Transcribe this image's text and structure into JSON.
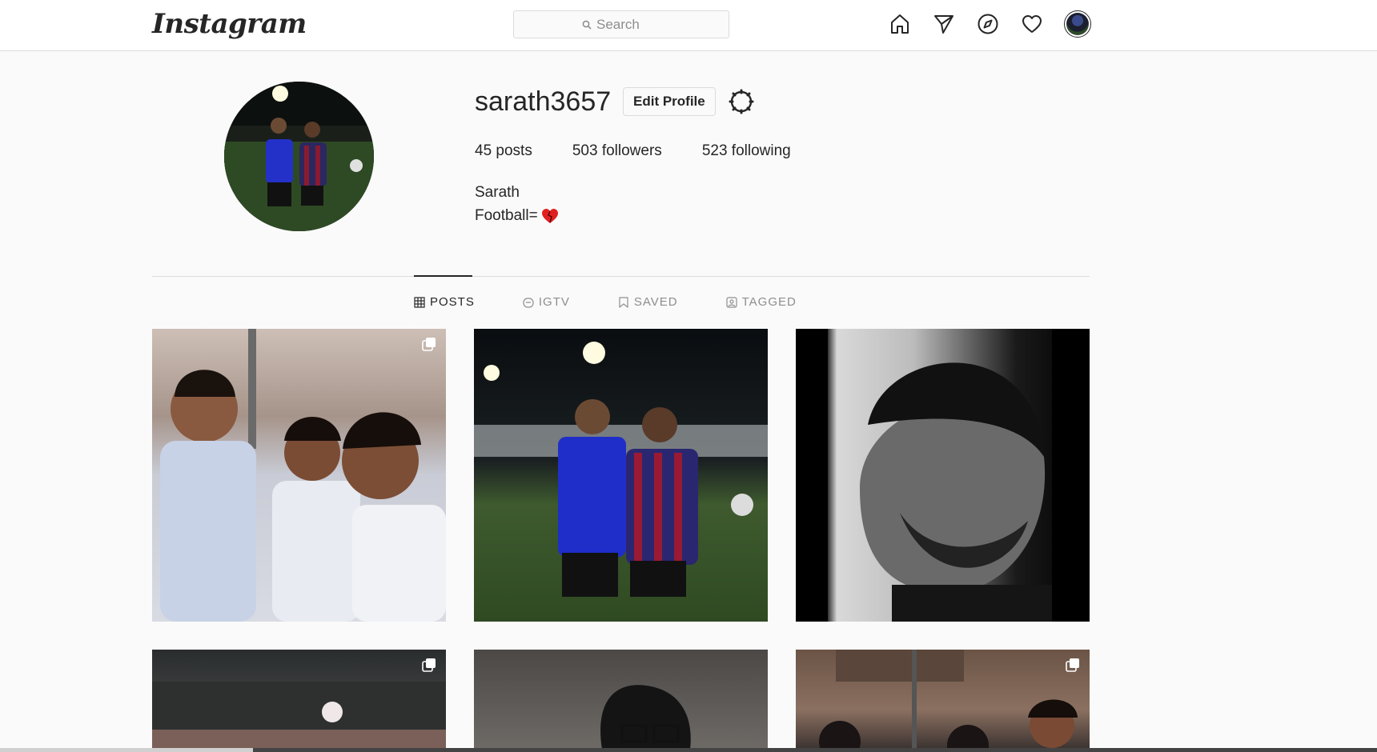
{
  "nav": {
    "logo": "Instagram",
    "search_placeholder": "Search",
    "icons": [
      "home-icon",
      "direct-icon",
      "explore-icon",
      "activity-heart-icon",
      "profile-avatar"
    ]
  },
  "profile": {
    "username": "sarath3657",
    "edit_label": "Edit Profile",
    "posts_count": "45",
    "posts_label": "posts",
    "followers_count": "503",
    "followers_label": "followers",
    "following_count": "523",
    "following_label": "following",
    "full_name": "Sarath",
    "bio": "Football="
  },
  "tabs": [
    {
      "label": "POSTS",
      "icon": "grid-icon",
      "active": true
    },
    {
      "label": "IGTV",
      "icon": "igtv-icon",
      "active": false
    },
    {
      "label": "SAVED",
      "icon": "bookmark-icon",
      "active": false
    },
    {
      "label": "TAGGED",
      "icon": "tagged-icon",
      "active": false
    }
  ],
  "posts": [
    {
      "multi": true
    },
    {
      "multi": false
    },
    {
      "multi": false
    },
    {
      "multi": true
    },
    {
      "multi": false
    },
    {
      "multi": true
    }
  ],
  "colors": {
    "border": "#dbdbdb",
    "text": "#262626",
    "muted": "#8e8e8e",
    "bg": "#fafafa"
  }
}
